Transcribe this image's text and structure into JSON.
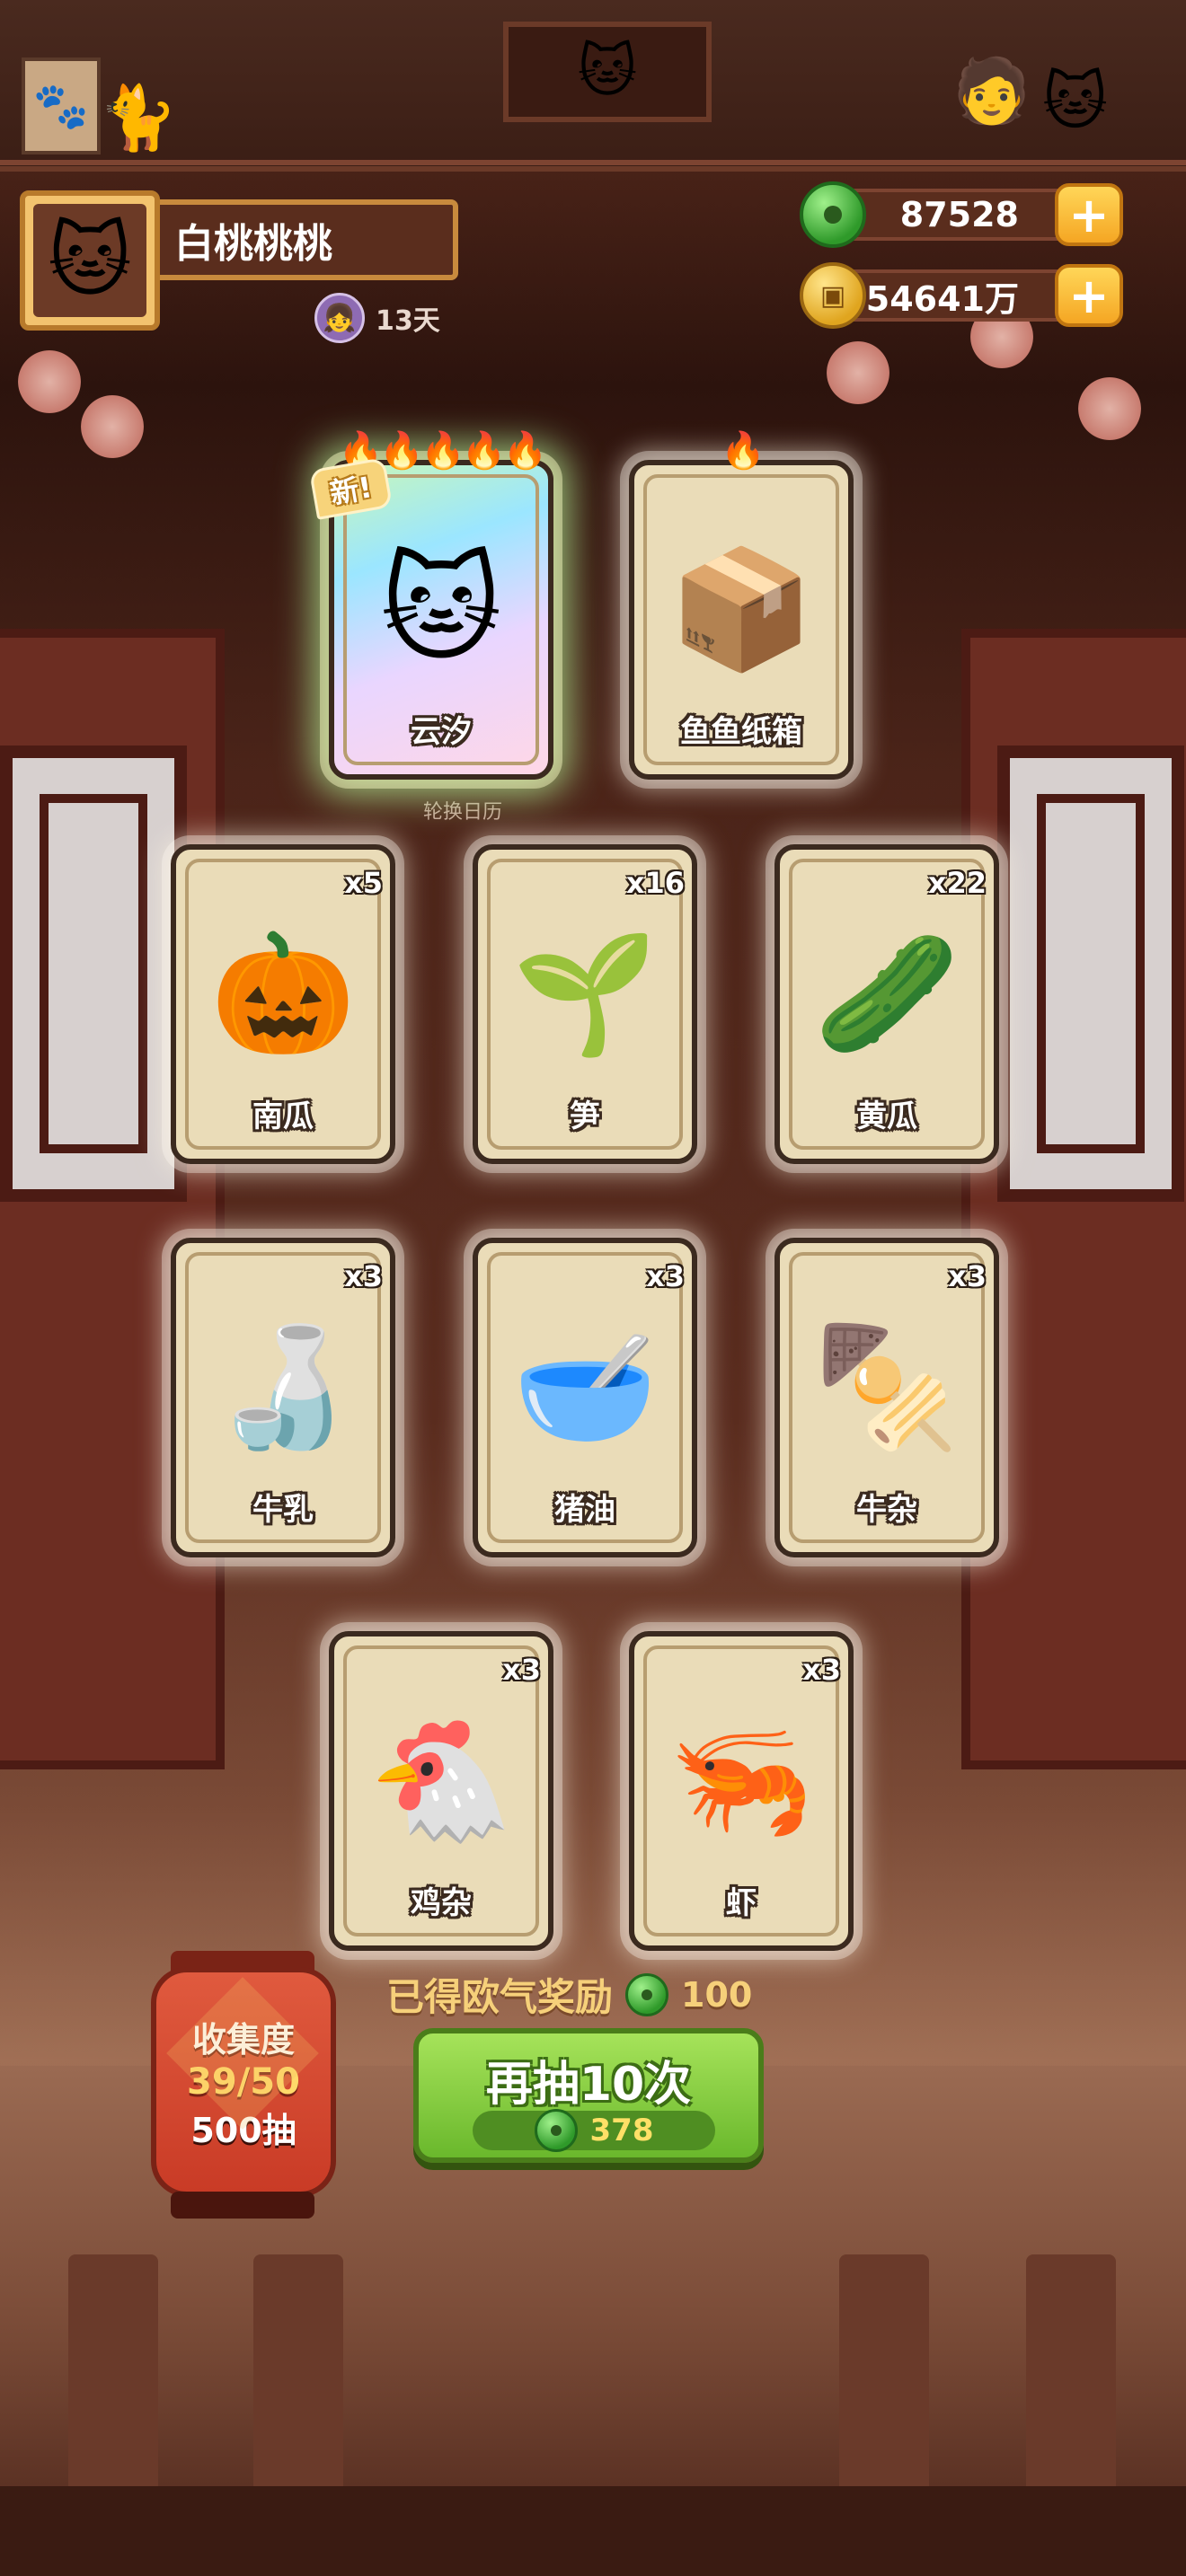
{
  "profile": {
    "avatar_icon": "white-cat-icon",
    "name": "白桃桃桃",
    "days": "13天"
  },
  "currency": {
    "jade_amount": "87528",
    "coin_amount": "54641万",
    "coin_glyph": "▣"
  },
  "gacha": {
    "calendar_label": "轮换日历",
    "cards": [
      {
        "label": "云汐",
        "count": "",
        "icon": "cat-character-icon",
        "art": "🐱",
        "flames": "🔥🔥🔥🔥🔥",
        "new_badge": "新!",
        "special": true
      },
      {
        "label": "鱼鱼纸箱",
        "count": "",
        "icon": "cat-in-box-icon",
        "art": "📦",
        "flames": "🔥",
        "new_badge": "",
        "special": false
      },
      {
        "label": "南瓜",
        "count": "x5",
        "icon": "pumpkin-icon",
        "art": "🎃"
      },
      {
        "label": "笋",
        "count": "x16",
        "icon": "bamboo-shoot-icon",
        "art": "🌱"
      },
      {
        "label": "黄瓜",
        "count": "x22",
        "icon": "cucumber-icon",
        "art": "🥒"
      },
      {
        "label": "牛乳",
        "count": "x3",
        "icon": "milk-jar-icon",
        "art": "🍶"
      },
      {
        "label": "猪油",
        "count": "x3",
        "icon": "lard-bowl-icon",
        "art": "🥣"
      },
      {
        "label": "牛杂",
        "count": "x3",
        "icon": "beef-offal-icon",
        "art": "🍢"
      },
      {
        "label": "鸡杂",
        "count": "x3",
        "icon": "chicken-giblets-icon",
        "art": "🐔"
      },
      {
        "label": "虾",
        "count": "x3",
        "icon": "shrimp-icon",
        "art": "🦐"
      }
    ],
    "reward_label": "已得欧气奖励",
    "reward_value": "100",
    "draw_button_label": "再抽10次",
    "draw_cost": "378"
  },
  "collection": {
    "title": "收集度",
    "progress": "39/50",
    "draws": "500抽"
  },
  "colors": {
    "accent_green": "#6ab82c",
    "gold": "#f6d07a",
    "lantern_red": "#c93b26"
  }
}
